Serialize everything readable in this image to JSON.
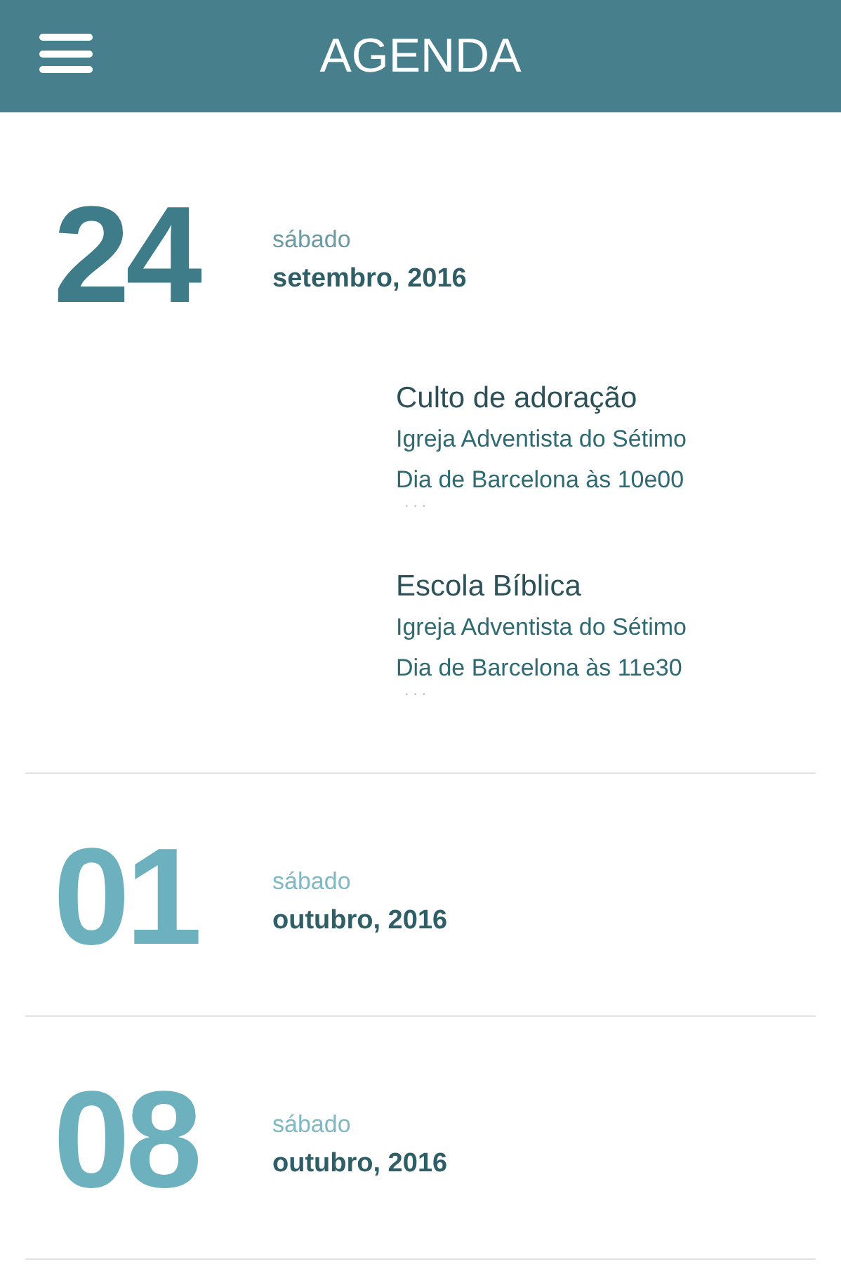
{
  "header": {
    "title": "AGENDA"
  },
  "days": [
    {
      "day": "24",
      "weekday": "sábado",
      "month": "setembro, 2016",
      "expanded": true,
      "events": [
        {
          "title": "Culto de adoração",
          "lines": [
            "Igreja Adventista do Sétimo",
            "Dia de Barcelona às 10e00"
          ],
          "more": "· · ·"
        },
        {
          "title": "Escola Bíblica",
          "lines": [
            "Igreja Adventista do Sétimo",
            "Dia de Barcelona às 11e30"
          ],
          "more": "· · ·"
        }
      ]
    },
    {
      "day": "01",
      "weekday": "sábado",
      "month": "outubro, 2016",
      "expanded": false
    },
    {
      "day": "08",
      "weekday": "sábado",
      "month": "outubro, 2016",
      "expanded": false
    }
  ]
}
